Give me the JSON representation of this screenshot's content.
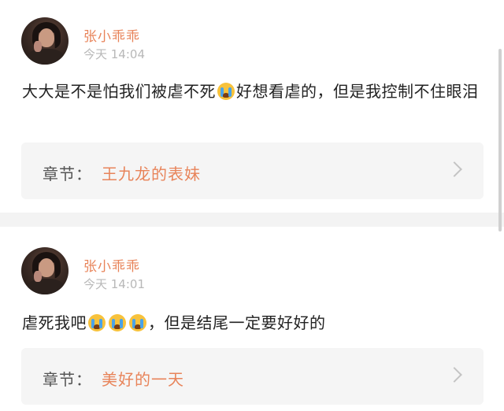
{
  "comments": [
    {
      "user": "张小乖乖",
      "time": "今天 14:04",
      "text_before_emoji": "大大是不是怕我们被虐不死",
      "emoji": "loudly-crying-face",
      "text_after_emoji": "好想看虐的，但是我控制不住眼泪",
      "chapter_label": "章节：",
      "chapter_title": "王九龙的表妹"
    },
    {
      "user": "张小乖乖",
      "time": "今天 14:01",
      "text_before_emoji": "虐死我吧",
      "emoji": "loudly-crying-face",
      "emoji_count": 3,
      "text_after_emoji": "，但是结尾一定要好好的",
      "chapter_label": "章节：",
      "chapter_title": "美好的一天"
    }
  ],
  "colors": {
    "accent": "#e8845a",
    "text": "#222222",
    "muted": "#b8b8b8",
    "chapter_bg": "#f5f5f5",
    "separator": "#f3f3f3"
  }
}
